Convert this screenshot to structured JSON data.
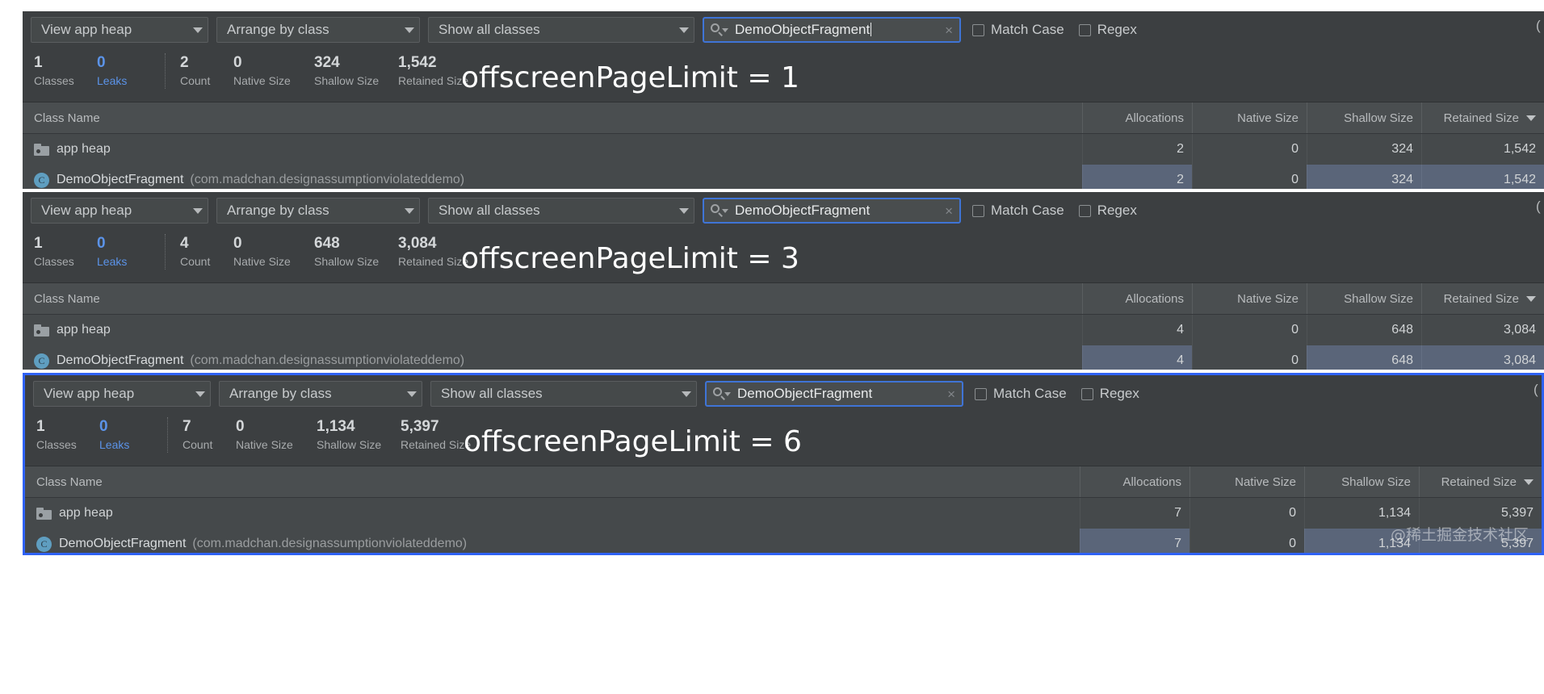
{
  "toolbar": {
    "view_heap_label": "View app heap",
    "arrange_label": "Arrange by class",
    "show_classes_label": "Show all classes",
    "search_value": "DemoObjectFragment",
    "search_clear": "×",
    "match_case_label": "Match Case",
    "regex_label": "Regex",
    "edge_stub": "("
  },
  "columns": {
    "class_name": "Class Name",
    "allocations": "Allocations",
    "native_size": "Native Size",
    "shallow_size": "Shallow Size",
    "retained_size": "Retained Size"
  },
  "stat_labels": {
    "classes": "Classes",
    "leaks": "Leaks",
    "count": "Count",
    "native_size": "Native Size",
    "shallow_size": "Shallow Size",
    "retained_size": "Retained Size"
  },
  "rows": {
    "app_heap_label": "app heap",
    "class_name": "DemoObjectFragment",
    "package": "(com.madchan.designassumptionviolateddemo)",
    "class_icon_letter": "C"
  },
  "colors": {
    "panel_bg": "#3c3f41",
    "row_bg": "#45494b",
    "header_bg": "#4a4e50",
    "selected_row": "#5a6579",
    "accent_blue": "#2f62f5",
    "leaks_blue": "#5b93e8",
    "focus_border": "#3f74d6"
  },
  "panels": [
    {
      "caption": "offscreenPageLimit = 1",
      "selected": false,
      "stats": {
        "classes": "1",
        "leaks": "0",
        "count": "2",
        "native_size": "0",
        "shallow_size": "324",
        "retained_size": "1,542"
      },
      "app_heap_row": {
        "allocations": "2",
        "native_size": "0",
        "shallow_size": "324",
        "retained_size": "1,542"
      },
      "class_row": {
        "allocations": "2",
        "native_size": "0",
        "shallow_size": "324",
        "retained_size": "1,542"
      }
    },
    {
      "caption": "offscreenPageLimit = 3",
      "selected": false,
      "stats": {
        "classes": "1",
        "leaks": "0",
        "count": "4",
        "native_size": "0",
        "shallow_size": "648",
        "retained_size": "3,084"
      },
      "app_heap_row": {
        "allocations": "4",
        "native_size": "0",
        "shallow_size": "648",
        "retained_size": "3,084"
      },
      "class_row": {
        "allocations": "4",
        "native_size": "0",
        "shallow_size": "648",
        "retained_size": "3,084"
      }
    },
    {
      "caption": "offscreenPageLimit = 6",
      "selected": true,
      "stats": {
        "classes": "1",
        "leaks": "0",
        "count": "7",
        "native_size": "0",
        "shallow_size": "1,134",
        "retained_size": "5,397"
      },
      "app_heap_row": {
        "allocations": "7",
        "native_size": "0",
        "shallow_size": "1,134",
        "retained_size": "5,397"
      },
      "class_row": {
        "allocations": "7",
        "native_size": "0",
        "shallow_size": "1,134",
        "retained_size": "5,397"
      }
    }
  ],
  "watermark": "@稀土掘金技术社区"
}
